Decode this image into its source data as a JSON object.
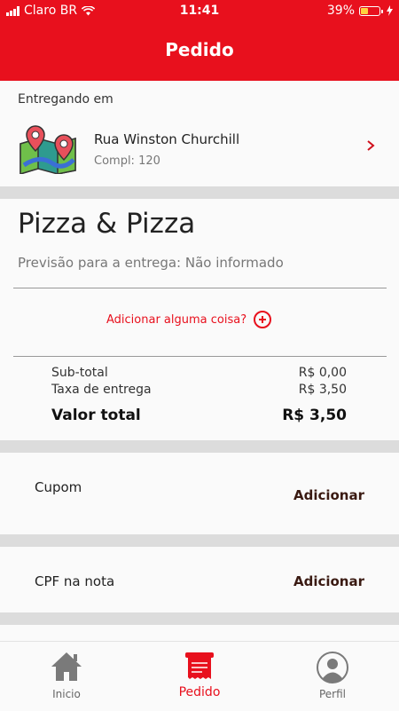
{
  "status_bar": {
    "carrier": "Claro BR",
    "time": "11:41",
    "battery": "39%",
    "battery_level": 0.39,
    "wifi_icon": "wifi-icon",
    "charging_icon": "charging-bolt-icon"
  },
  "header": {
    "title": "Pedido",
    "color": "#e8101d"
  },
  "delivery": {
    "caption": "Entregando em",
    "street": "Rua Winston Churchill",
    "complement": "Compl: 120",
    "icon": "map-pin-icon",
    "chevron_icon": "chevron-right-icon"
  },
  "store": {
    "name": "Pizza & Pizza",
    "eta": "Previsão para a entrega: Não informado"
  },
  "add_more": {
    "label": "Adicionar alguma coisa?",
    "icon": "plus-circle-icon"
  },
  "summary": {
    "subtotal_label": "Sub-total",
    "subtotal_value": "R$ 0,00",
    "delivery_fee_label": "Taxa de entrega",
    "delivery_fee_value": "R$ 3,50",
    "total_label": "Valor total",
    "total_value": "R$ 3,50"
  },
  "coupon": {
    "label": "Cupom",
    "action": "Adicionar"
  },
  "cpf": {
    "label": "CPF na nota",
    "action": "Adicionar"
  },
  "tabbar": {
    "tabs": [
      {
        "label": "Inicio",
        "icon": "home-icon",
        "active": false
      },
      {
        "label": "Pedido",
        "icon": "receipt-icon",
        "active": true
      },
      {
        "label": "Perfil",
        "icon": "user-icon",
        "active": false
      }
    ]
  }
}
